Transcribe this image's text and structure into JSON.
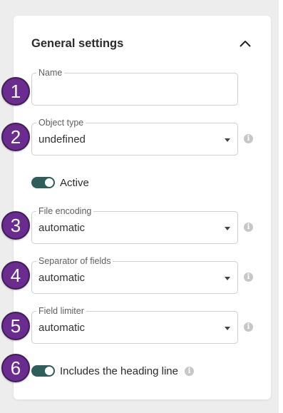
{
  "panel": {
    "title": "General settings"
  },
  "fields": {
    "name": {
      "label": "Name",
      "value": ""
    },
    "object_type": {
      "label": "Object type",
      "value": "undefined"
    },
    "file_encoding": {
      "label": "File encoding",
      "value": "automatic"
    },
    "separator": {
      "label": "Separator of fields",
      "value": "automatic"
    },
    "field_limiter": {
      "label": "Field limiter",
      "value": "automatic"
    }
  },
  "toggles": {
    "active": {
      "label": "Active",
      "on": true
    },
    "heading_line": {
      "label": "Includes the heading line",
      "on": true
    }
  },
  "badges": [
    "1",
    "2",
    "3",
    "4",
    "5",
    "6"
  ],
  "info_glyph": "i",
  "colors": {
    "badge_fill": "#6a2c8e",
    "toggle_on": "#2f5d5a"
  }
}
